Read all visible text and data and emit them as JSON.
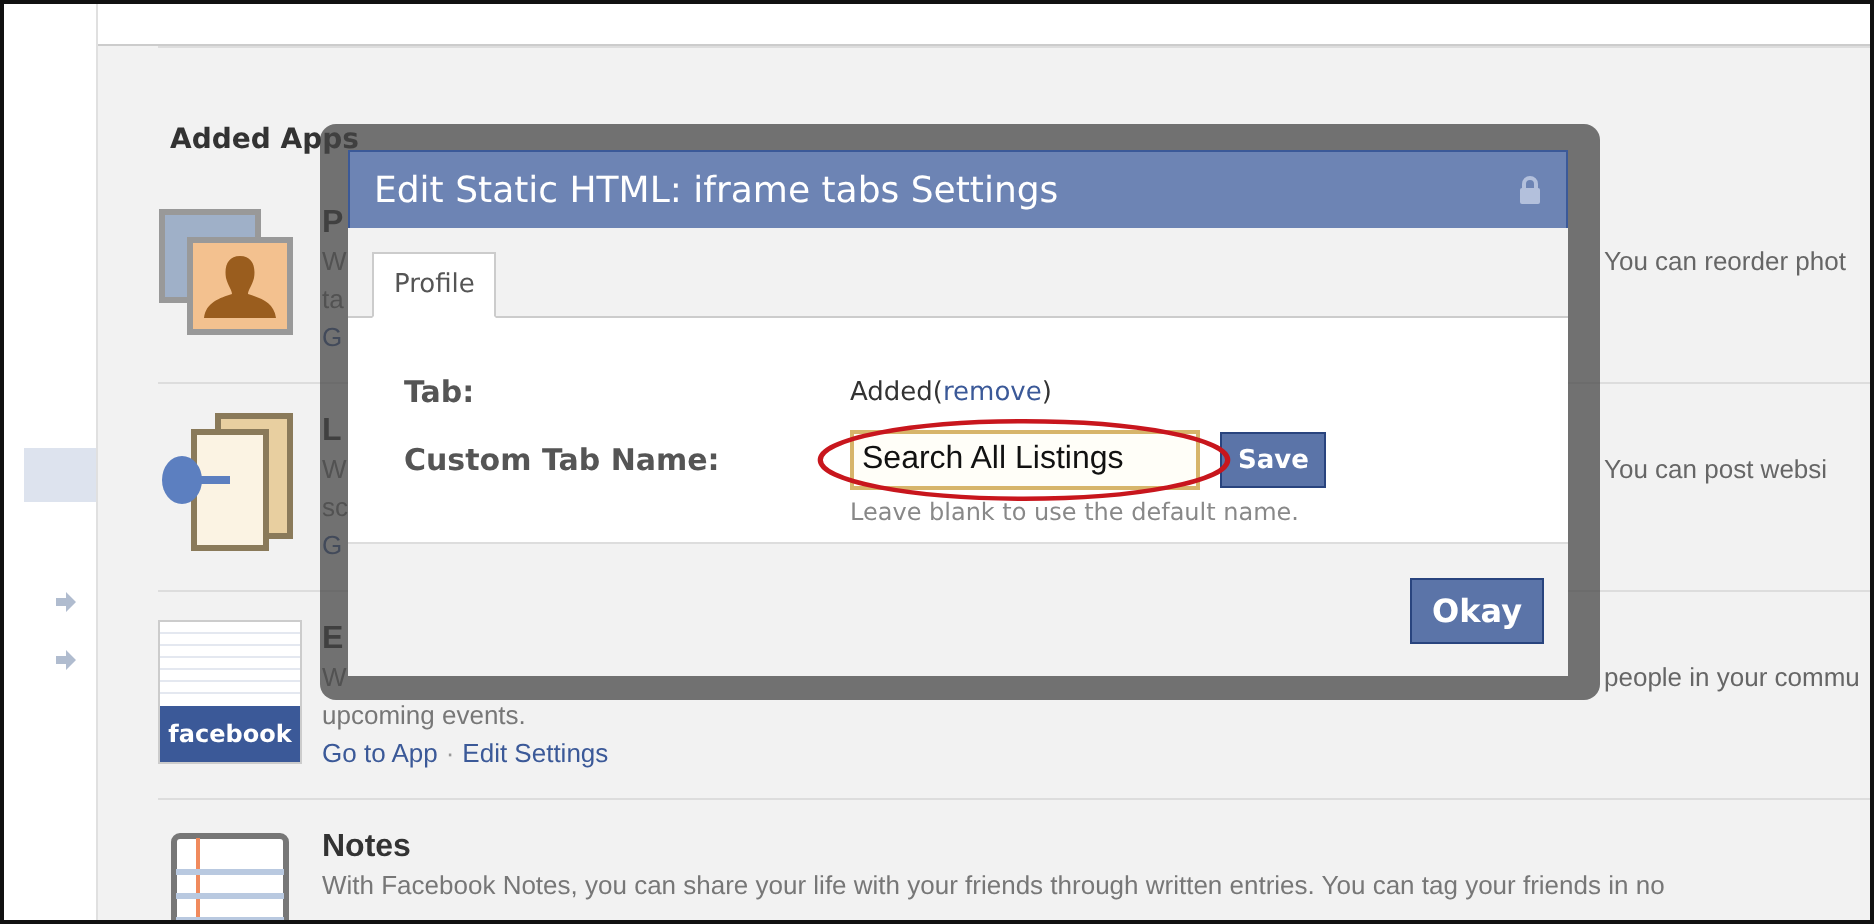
{
  "heading": "Added Apps",
  "apps": [
    {
      "kind": "photos",
      "title": "P",
      "lines": [
        {
          "left": "W",
          "right": "You can reorder phot"
        },
        {
          "left": "ta"
        }
      ],
      "links": [
        "G"
      ]
    },
    {
      "kind": "pin",
      "title": "L",
      "lines": [
        {
          "left": "W",
          "right": "You can post websi"
        },
        {
          "left": "sc"
        }
      ],
      "links": [
        "G"
      ]
    },
    {
      "kind": "events",
      "title": "E",
      "icon_label": "facebook",
      "lines": [
        {
          "left": "W",
          "right": "people in your commu"
        },
        {
          "left": "upcoming events."
        }
      ],
      "links": [
        "Go to App",
        "Edit Settings"
      ],
      "link_separator": "·"
    },
    {
      "kind": "notes",
      "title": "Notes",
      "lines": [
        {
          "left": "With Facebook Notes, you can share your life with your friends through written entries. You can tag your friends in no"
        }
      ]
    }
  ],
  "dialog": {
    "title": "Edit Static HTML: iframe tabs Settings",
    "tabs": [
      {
        "label": "Profile",
        "selected": true
      }
    ],
    "tab_label": "Tab:",
    "tab_status": "Added",
    "tab_link_open": "(",
    "tab_link": "remove",
    "tab_link_close": ")",
    "name_label": "Custom Tab Name:",
    "name_value": "Search All Listings",
    "save": "Save",
    "hint": "Leave blank to use the default name.",
    "okay": "Okay"
  }
}
